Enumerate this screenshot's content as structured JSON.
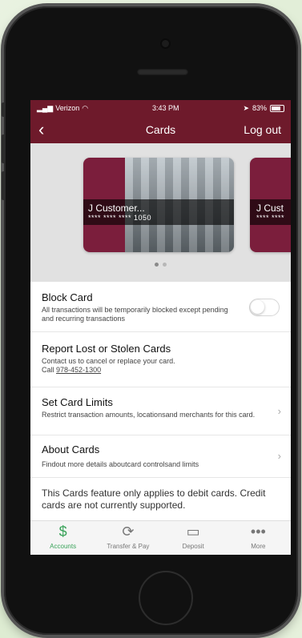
{
  "status": {
    "carrier": "Verizon",
    "time": "3:43 PM",
    "battery": "83%"
  },
  "nav": {
    "title": "Cards",
    "logout_label": "Log out",
    "back_glyph": "‹"
  },
  "cards": [
    {
      "name": "J Customer...",
      "number": "**** **** **** 1050"
    },
    {
      "name": "J Cust",
      "number": "**** ****"
    }
  ],
  "rows": {
    "block": {
      "title": "Block Card",
      "desc": "All transactions will be temporarily blocked except pending and recurring transactions",
      "toggle_on": false
    },
    "report": {
      "title": "Report Lost or Stolen Cards",
      "desc": "Contact us to cancel or replace your card.",
      "call_prefix": "Call",
      "phone": "978-452-1300"
    },
    "limits": {
      "title": "Set Card Limits",
      "desc": "Restrict transaction amounts, locationsand merchants for this card."
    },
    "about": {
      "title": "About Cards",
      "desc": "Findout more details aboutcard controlsand limits"
    }
  },
  "note": "This Cards feature only applies to debit cards. Credit cards are not currently supported.",
  "tabs": [
    {
      "label": "Accounts",
      "icon": "dollar-icon",
      "active": true
    },
    {
      "label": "Transfer & Pay",
      "icon": "transfer-icon",
      "active": false
    },
    {
      "label": "Deposit",
      "icon": "deposit-icon",
      "active": false
    },
    {
      "label": "More",
      "icon": "more-icon",
      "active": false
    }
  ],
  "colors": {
    "brand": "#6e1a2b",
    "card": "#7b1e3c",
    "active_tab": "#3aa35a"
  }
}
